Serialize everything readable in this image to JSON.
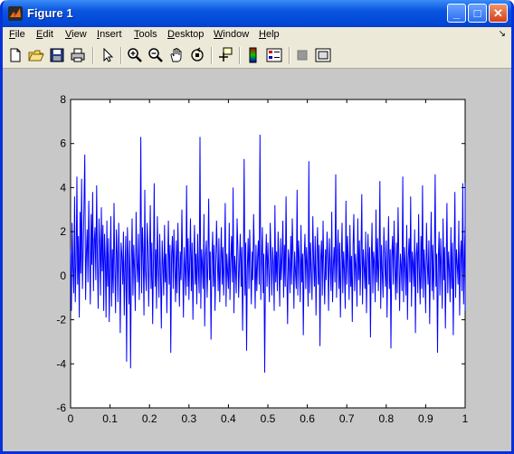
{
  "window": {
    "title": "Figure 1",
    "controls": {
      "minimize": "_",
      "maximize": "□",
      "close": "✕"
    }
  },
  "menubar": {
    "items": [
      {
        "label": "File",
        "accel": "F"
      },
      {
        "label": "Edit",
        "accel": "E"
      },
      {
        "label": "View",
        "accel": "V"
      },
      {
        "label": "Insert",
        "accel": "I"
      },
      {
        "label": "Tools",
        "accel": "T"
      },
      {
        "label": "Desktop",
        "accel": "D"
      },
      {
        "label": "Window",
        "accel": "W"
      },
      {
        "label": "Help",
        "accel": "H"
      }
    ]
  },
  "toolbar": {
    "icons": [
      "new-figure-icon",
      "open-file-icon",
      "save-icon",
      "print-icon",
      "pointer-icon",
      "zoom-in-icon",
      "zoom-out-icon",
      "pan-hand-icon",
      "rotate-3d-icon",
      "data-cursor-icon",
      "colorbar-icon",
      "legend-icon",
      "hide-plot-tools-icon",
      "show-plot-tools-icon"
    ]
  },
  "colors": {
    "line": "#0000ff",
    "axes_bg": "#ffffff",
    "figure_bg": "#c8c8c8"
  },
  "chart_data": {
    "type": "line",
    "title": "",
    "xlabel": "",
    "ylabel": "",
    "xlim": [
      0,
      1
    ],
    "ylim": [
      -6,
      8
    ],
    "xticks": [
      0,
      0.1,
      0.2,
      0.3,
      0.4,
      0.5,
      0.6,
      0.7,
      0.8,
      0.9,
      1
    ],
    "yticks": [
      -6,
      -4,
      -2,
      0,
      2,
      4,
      6,
      8
    ],
    "xtick_labels": [
      "0",
      "0.1",
      "0.2",
      "0.3",
      "0.4",
      "0.5",
      "0.6",
      "0.7",
      "0.8",
      "0.9",
      "1"
    ],
    "ytick_labels": [
      "-6",
      "-4",
      "-2",
      "0",
      "2",
      "4",
      "6",
      "8"
    ],
    "grid": false,
    "series": [
      {
        "color": "#0000ff",
        "x_start": 0,
        "x_step": 0.002,
        "y": [
          1.2,
          -1.6,
          2.4,
          0.3,
          -0.8,
          3.6,
          -1.2,
          0.6,
          4.5,
          -0.4,
          1.8,
          -1.9,
          2.9,
          0.1,
          4.4,
          -0.6,
          1.3,
          3.2,
          5.5,
          -1.1,
          0.9,
          2.1,
          -0.3,
          3.4,
          1.1,
          -1.3,
          2.8,
          0.5,
          3.8,
          -0.7,
          1.6,
          2.2,
          -0.2,
          4.1,
          0.8,
          -1.5,
          2.6,
          1.4,
          -0.9,
          3.1,
          0.2,
          2.3,
          -1.6,
          1.9,
          0.7,
          -1.9,
          2.5,
          -0.5,
          1.7,
          -2.1,
          0.4,
          2.7,
          -1.4,
          1.2,
          -0.8,
          3.3,
          0.6,
          -1.7,
          2.1,
          1.0,
          -1.2,
          2.4,
          0.3,
          -2.6,
          1.5,
          0.9,
          -0.4,
          2.0,
          -1.8,
          0.5,
          1.8,
          -3.9,
          2.2,
          0.8,
          -1.3,
          1.6,
          -4.2,
          0.2,
          2.6,
          -0.9,
          1.4,
          0.4,
          -1.6,
          2.9,
          0.7,
          -0.3,
          1.9,
          -1.1,
          0.6,
          6.3,
          -0.8,
          2.2,
          1.1,
          -1.8,
          3.9,
          0.2,
          -0.7,
          2.4,
          1.3,
          -1.4,
          0.9,
          3.2,
          -0.6,
          1.5,
          -2.2,
          0.8,
          4.2,
          -0.5,
          1.2,
          -1.5,
          2.7,
          0.4,
          -1.0,
          1.9,
          0.1,
          -2.4,
          1.6,
          0.6,
          -0.9,
          2.3,
          -0.3,
          1.0,
          -1.7,
          0.7,
          2.5,
          -0.4,
          1.4,
          -3.5,
          0.9,
          1.8,
          -0.6,
          2.1,
          0.3,
          -1.2,
          1.6,
          -0.8,
          2.4,
          0.5,
          -1.4,
          1.1,
          -0.2,
          3.0,
          0.7,
          -1.9,
          1.3,
          0.4,
          -0.9,
          4.1,
          -0.5,
          1.7,
          -1.1,
          0.8,
          2.6,
          -0.7,
          1.5,
          -2.0,
          0.6,
          2.3,
          -0.4,
          1.0,
          -1.3,
          1.9,
          0.2,
          -0.8,
          6.3,
          -1.5,
          1.2,
          0.5,
          -0.6,
          2.8,
          -2.3,
          0.9,
          1.6,
          -1.0,
          0.4,
          3.5,
          -0.2,
          1.1,
          -2.9,
          0.7,
          2.0,
          -0.5,
          1.4,
          -1.6,
          0.3,
          2.5,
          0.8,
          -0.7,
          1.7,
          -1.2,
          0.6,
          2.2,
          -0.4,
          1.3,
          -0.9,
          0.5,
          3.3,
          -1.4,
          1.0,
          0.2,
          -0.6,
          2.4,
          -1.1,
          0.7,
          1.8,
          -0.3,
          4.0,
          -1.7,
          0.9,
          0.4,
          -0.8,
          2.6,
          1.2,
          -1.0,
          0.6,
          1.9,
          -0.5,
          1.3,
          -2.5,
          0.8,
          5.3,
          -0.9,
          1.5,
          -3.4,
          0.3,
          1.7,
          -0.6,
          2.1,
          0.5,
          -1.3,
          1.1,
          -0.2,
          2.8,
          0.7,
          -1.5,
          1.4,
          -0.7,
          0.9,
          1.6,
          -0.4,
          6.4,
          -1.1,
          0.6,
          2.2,
          -0.8,
          1.0,
          -4.4,
          0.4,
          1.9,
          -0.5,
          1.5,
          0.2,
          -1.2,
          2.4,
          0.8,
          -0.9,
          1.3,
          0.5,
          -1.6,
          3.2,
          -0.3,
          1.1,
          -0.7,
          2.0,
          0.6,
          -1.4,
          1.7,
          -0.2,
          0.9,
          2.5,
          -1.0,
          1.4,
          -0.5,
          3.6,
          0.3,
          -2.2,
          1.2,
          0.7,
          -0.8,
          1.8,
          -0.4,
          2.6,
          0.9,
          -1.5,
          1.1,
          0.2,
          -0.6,
          3.9,
          -0.9,
          1.6,
          0.5,
          -1.2,
          2.3,
          -0.3,
          1.0,
          -2.7,
          0.8,
          1.9,
          -0.6,
          1.3,
          0.4,
          -1.4,
          5.2,
          -0.8,
          1.5,
          0.1,
          -1.1,
          2.7,
          0.6,
          -0.5,
          1.8,
          -1.8,
          0.9,
          2.2,
          -0.4,
          1.4,
          -3.2,
          0.7,
          1.6,
          -0.9,
          2.5,
          0.3,
          -1.3,
          1.2,
          -0.2,
          2.0,
          0.8,
          -1.6,
          1.7,
          0.4,
          -0.7,
          2.9,
          -1.2,
          0.5,
          1.3,
          -0.3,
          4.6,
          -1.0,
          0.9,
          2.1,
          -0.6,
          1.5,
          -1.9,
          0.6,
          2.4,
          -0.8,
          1.1,
          0.2,
          -1.5,
          3.4,
          -0.4,
          1.8,
          0.7,
          -1.1,
          2.3,
          -0.5,
          0.9,
          -2.1,
          1.4,
          2.8,
          -0.7,
          1.0,
          0.3,
          -1.4,
          2.6,
          -0.2,
          1.6,
          -0.9,
          0.8,
          3.7,
          -1.3,
          1.2,
          0.4,
          -0.6,
          2.0,
          -1.7,
          0.7,
          1.9,
          -0.4,
          1.3,
          -2.8,
          0.5,
          2.4,
          -0.8,
          1.1,
          0.6,
          -1.2,
          3.0,
          -0.3,
          1.7,
          -0.7,
          0.9,
          4.3,
          -1.5,
          1.4,
          0.2,
          -1.0,
          2.2,
          0.8,
          -0.5,
          1.6,
          -1.9,
          0.6,
          2.7,
          -0.6,
          1.2,
          -3.3,
          0.9,
          1.8,
          -0.4,
          2.5,
          0.3,
          -1.1,
          1.5,
          -0.8,
          3.1,
          0.7,
          -1.6,
          1.0,
          0.4,
          -0.7,
          4.5,
          -1.2,
          1.3,
          0.5,
          -0.9,
          2.3,
          -2.0,
          0.8,
          1.7,
          -0.3,
          3.6,
          -1.4,
          1.1,
          0.6,
          -0.5,
          2.1,
          -2.6,
          0.9,
          1.5,
          -0.8,
          2.8,
          0.2,
          -1.3,
          1.8,
          -0.6,
          4.1,
          -1.0,
          1.2,
          0.3,
          -1.7,
          2.4,
          0.7,
          -0.4,
          1.6,
          -2.2,
          0.5,
          2.9,
          -0.7,
          1.4,
          -1.1,
          0.9,
          4.6,
          -0.5,
          1.0,
          -3.5,
          0.8,
          2.0,
          -0.9,
          1.7,
          0.4,
          -1.5,
          2.6,
          -0.2,
          1.3,
          -2.4,
          0.6,
          3.3,
          -0.8,
          1.1,
          0.2,
          -1.2,
          2.2,
          -0.6,
          1.5,
          -2.7,
          0.7,
          3.8,
          -1.0,
          1.2,
          0.5,
          -0.4,
          2.5,
          -1.8,
          0.9,
          1.6,
          -0.7,
          4.2,
          -1.3,
          0.8,
          2.3,
          -0.9,
          1.1,
          -0.3,
          3.0,
          -1.6,
          0.6,
          2.7,
          -0.5,
          1.4,
          0.3,
          3.9,
          -1.1,
          4.2,
          2.6,
          3.1,
          1.2,
          3.8
        ]
      }
    ]
  }
}
